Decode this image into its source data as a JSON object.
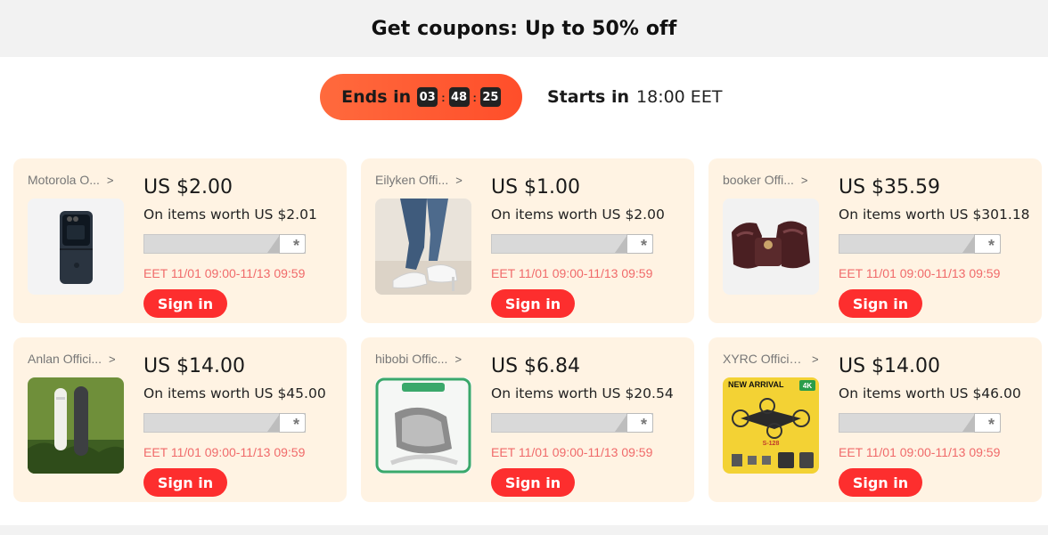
{
  "header": {
    "title": "Get coupons: Up to 50% off"
  },
  "timer": {
    "ends_label": "Ends in",
    "hours": "03",
    "minutes": "48",
    "seconds": "25",
    "separator": ":",
    "starts_label": "Starts in",
    "starts_time": "18:00 EET",
    "pill_color": "#ff5a33"
  },
  "colors": {
    "card_bg": "#fff3e3",
    "button": "#fd2e2e",
    "date_text": "#f06a6a"
  },
  "coupons": [
    {
      "store": "Motorola O...",
      "price": "US $2.00",
      "worth": "On items worth US $2.01",
      "date": "EET 11/01 09:00-11/13 09:59",
      "button": "Sign in",
      "image": "phone-image"
    },
    {
      "store": "Eilyken Offi...",
      "price": "US $1.00",
      "worth": "On items worth US $2.00",
      "date": "EET 11/01 09:00-11/13 09:59",
      "button": "Sign in",
      "image": "sandal-image"
    },
    {
      "store": "booker Offi...",
      "price": "US $35.59",
      "worth": "On items worth US $301.18",
      "date": "EET 11/01 09:00-11/13 09:59",
      "button": "Sign in",
      "image": "foot-massager-image"
    },
    {
      "store": "Anlan Offici...",
      "price": "US $14.00",
      "worth": "On items worth US $45.00",
      "date": "EET 11/01 09:00-11/13 09:59",
      "button": "Sign in",
      "image": "hair-device-image"
    },
    {
      "store": "hibobi Offic...",
      "price": "US $6.84",
      "worth": "On items worth US $20.54",
      "date": "EET 11/01 09:00-11/13 09:59",
      "button": "Sign in",
      "image": "baby-rocker-image"
    },
    {
      "store": "XYRC Officia...",
      "price": "US $14.00",
      "worth": "On items worth US $46.00",
      "date": "EET 11/01 09:00-11/13 09:59",
      "button": "Sign in",
      "image": "drone-image",
      "image_text": {
        "new_arrival": "NEW ARRIVAL",
        "badge": "4K",
        "model": "S-128"
      }
    }
  ]
}
